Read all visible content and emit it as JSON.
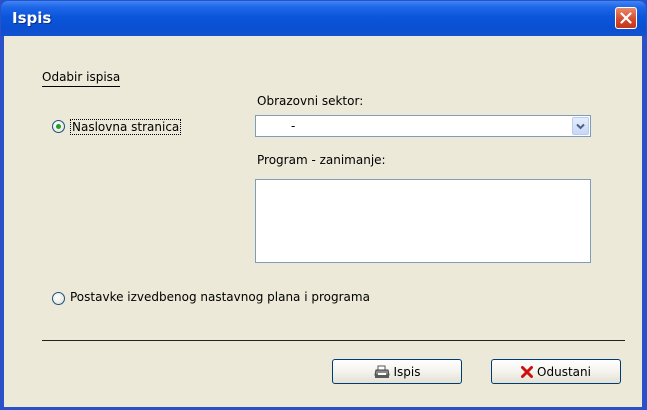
{
  "window": {
    "title": "Ispis"
  },
  "group": {
    "label": "Odabir ispisa"
  },
  "options": [
    {
      "label": "Naslovna stranica",
      "selected": true
    },
    {
      "label": "Postavke izvedbenog nastavnog plana i programa",
      "selected": false
    }
  ],
  "sector": {
    "label": "Obrazovni sektor:",
    "value": "-"
  },
  "program": {
    "label": "Program - zanimanje:",
    "value": ""
  },
  "buttons": {
    "print_label": "Ispis",
    "cancel_label": "Odustani"
  },
  "icons": {
    "close": "close-icon",
    "dropdown": "chevron-down-icon",
    "print": "printer-icon",
    "cancel": "x-icon"
  },
  "colors": {
    "titlebar": "#0a4fd2",
    "dialog_bg": "#ece9d8",
    "close_button": "#d2482a",
    "radio_dot": "#21a121",
    "cancel_x": "#cc1111"
  }
}
